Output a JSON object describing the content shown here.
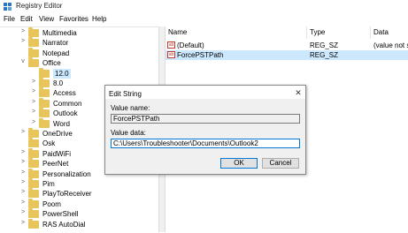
{
  "window": {
    "title": "Registry Editor"
  },
  "menu": [
    "File",
    "Edit",
    "View",
    "Favorites",
    "Help"
  ],
  "tree": [
    {
      "label": "Multimedia",
      "arrow": ">",
      "level": 0
    },
    {
      "label": "Narrator",
      "arrow": ">",
      "level": 0
    },
    {
      "label": "Notepad",
      "arrow": "",
      "level": 0
    },
    {
      "label": "Office",
      "arrow": "v",
      "level": 0
    },
    {
      "label": "12.0",
      "arrow": "",
      "level": 1,
      "selected": true
    },
    {
      "label": "8.0",
      "arrow": ">",
      "level": 1
    },
    {
      "label": "Access",
      "arrow": ">",
      "level": 1
    },
    {
      "label": "Common",
      "arrow": ">",
      "level": 1
    },
    {
      "label": "Outlook",
      "arrow": ">",
      "level": 1
    },
    {
      "label": "Word",
      "arrow": ">",
      "level": 1
    },
    {
      "label": "OneDrive",
      "arrow": ">",
      "level": 0
    },
    {
      "label": "Osk",
      "arrow": "",
      "level": 0
    },
    {
      "label": "PaidWiFi",
      "arrow": ">",
      "level": 0
    },
    {
      "label": "PeerNet",
      "arrow": ">",
      "level": 0
    },
    {
      "label": "Personalization",
      "arrow": ">",
      "level": 0
    },
    {
      "label": "Pim",
      "arrow": ">",
      "level": 0
    },
    {
      "label": "PlayToReceiver",
      "arrow": ">",
      "level": 0
    },
    {
      "label": "Poom",
      "arrow": ">",
      "level": 0
    },
    {
      "label": "PowerShell",
      "arrow": ">",
      "level": 0
    },
    {
      "label": "RAS AutoDial",
      "arrow": ">",
      "level": 0
    }
  ],
  "columns": {
    "name": "Name",
    "type": "Type",
    "data": "Data"
  },
  "values": [
    {
      "name": "(Default)",
      "type": "REG_SZ",
      "data": "(value not set)",
      "selected": false
    },
    {
      "name": "ForcePSTPath",
      "type": "REG_SZ",
      "data": "",
      "selected": true
    }
  ],
  "dialog": {
    "title": "Edit String",
    "close": "✕",
    "value_name_label": "Value name:",
    "value_name": "ForcePSTPath",
    "value_data_label": "Value data:",
    "value_data": "C:\\Users\\Troubleshooter\\Documents\\Outlook2",
    "ok": "OK",
    "cancel": "Cancel"
  }
}
